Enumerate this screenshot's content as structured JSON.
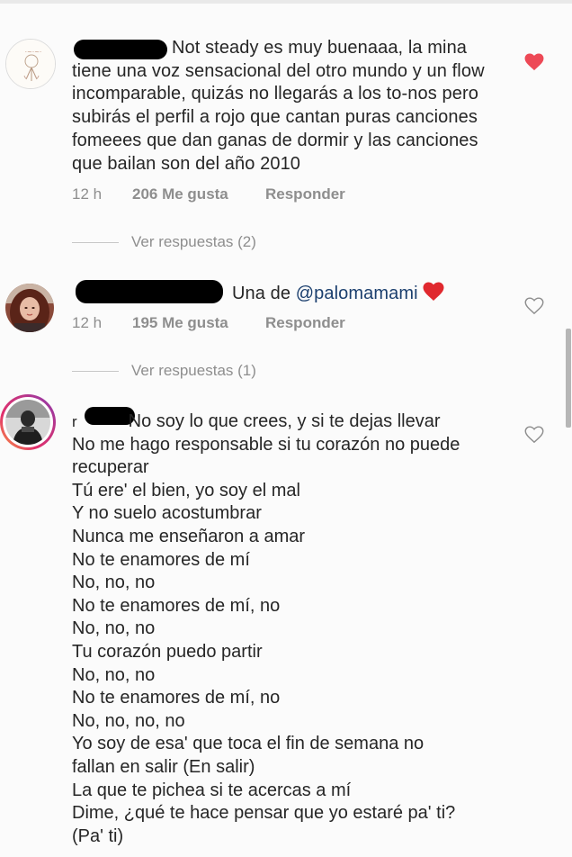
{
  "comments": [
    {
      "text": "Not steady es muy buenaaa, la mina tiene una voz sensacional del otro mundo y un flow incomparable, quizás no llegarás a los to-nos pero subirás el perfil a rojo que cantan puras canciones fomeees que dan ganas de dormir y las canciones que bailan son del año 2010",
      "time": "12 h",
      "likes": "206 Me gusta",
      "reply": "Responder",
      "liked": true,
      "view_replies": "Ver respuestas (2)"
    },
    {
      "text": "Una de",
      "mention": "@palomamami",
      "emoji": "❤️",
      "time": "12 h",
      "likes": "195 Me gusta",
      "reply": "Responder",
      "liked": false,
      "view_replies": "Ver respuestas (1)"
    },
    {
      "lines": [
        "No soy lo que crees, y si te dejas llevar",
        "No me hago responsable si tu corazón no puede",
        "recuperar",
        "Tú ere' el bien, yo soy el mal",
        "Y no suelo acostumbrar",
        "Nunca me enseñaron a amar",
        "No te enamores de mí",
        "No, no, no",
        "No te enamores de mí, no",
        "No, no, no",
        "Tu corazón puedo partir",
        "No, no, no",
        "No te enamores de mí, no",
        "No, no, no, no",
        "Yo soy de esa' que toca el fin de semana no",
        "fallan en salir (En salir)",
        "La que te pichea si te acercas a mí",
        "Dime, ¿qué te hace pensar que yo estaré pa' ti?",
        "(Pa' ti)"
      ],
      "liked": false
    }
  ],
  "colors": {
    "text": "#262626",
    "meta": "#8e8e8e",
    "liked_heart": "#ed4956",
    "mention": "#1b3f6e",
    "story_ring": "#d6249f"
  },
  "icons": {
    "like_filled": "heart-filled-icon",
    "like_outline": "heart-outline-icon"
  }
}
